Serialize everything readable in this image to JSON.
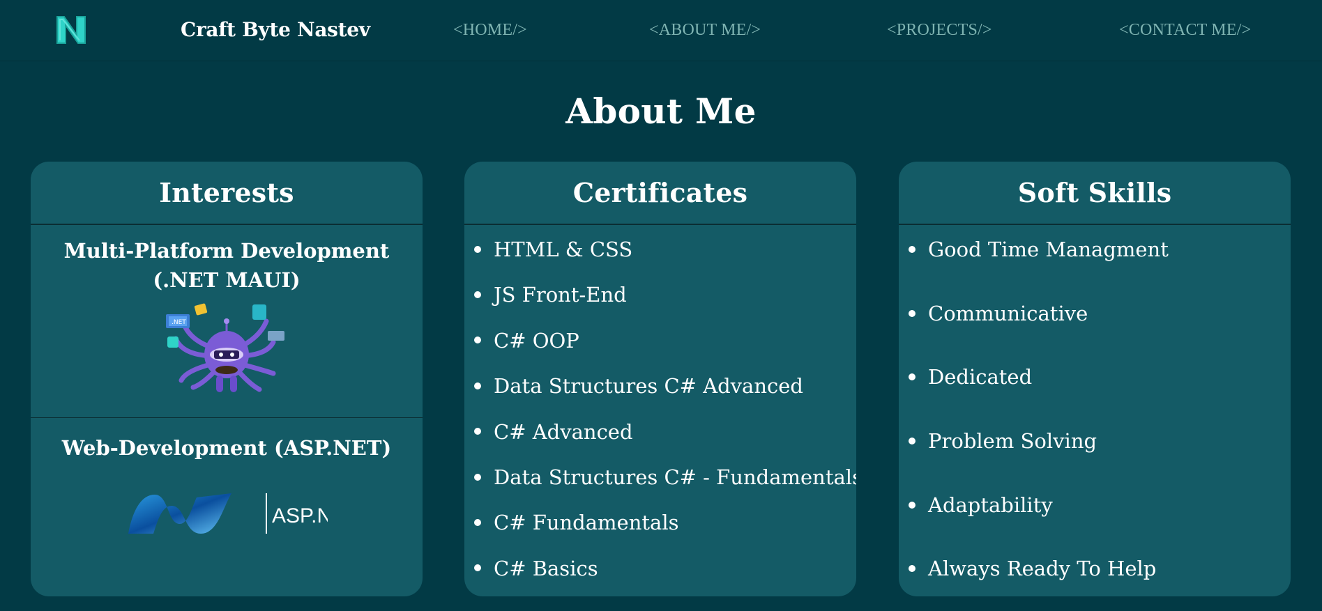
{
  "nav": {
    "logo_letter": "N",
    "brand": "Craft Byte Nastev",
    "links": [
      "<HOME/>",
      "<ABOUT ME/>",
      "<PROJECTS/>",
      "<CONTACT ME/>"
    ]
  },
  "page_title": "About Me",
  "cards": {
    "interests": {
      "title": "Interests",
      "items": [
        {
          "label": "Multi-Platform Development (.NET MAUI)",
          "image_badge": ".NET"
        },
        {
          "label": "Web-Development (ASP.NET)",
          "image_text": "ASP.NET"
        }
      ]
    },
    "certificates": {
      "title": "Certificates",
      "items": [
        "HTML & CSS",
        "JS Front-End",
        "C# OOP",
        "Data Structures C# Advanced",
        "C# Advanced",
        "Data Structures C# - Fundamentals",
        "C# Fundamentals",
        "C# Basics"
      ]
    },
    "soft_skills": {
      "title": "Soft Skills",
      "items": [
        "Good Time Managment",
        "Communicative",
        "Dedicated",
        "Problem Solving",
        "Adaptability",
        "Always Ready To Help"
      ]
    }
  },
  "colors": {
    "background": "#023a45",
    "card": "#145b66",
    "nav_link": "#7fb4b2",
    "logo": "#2fd3c8",
    "mascot": "#7b5cd6"
  }
}
